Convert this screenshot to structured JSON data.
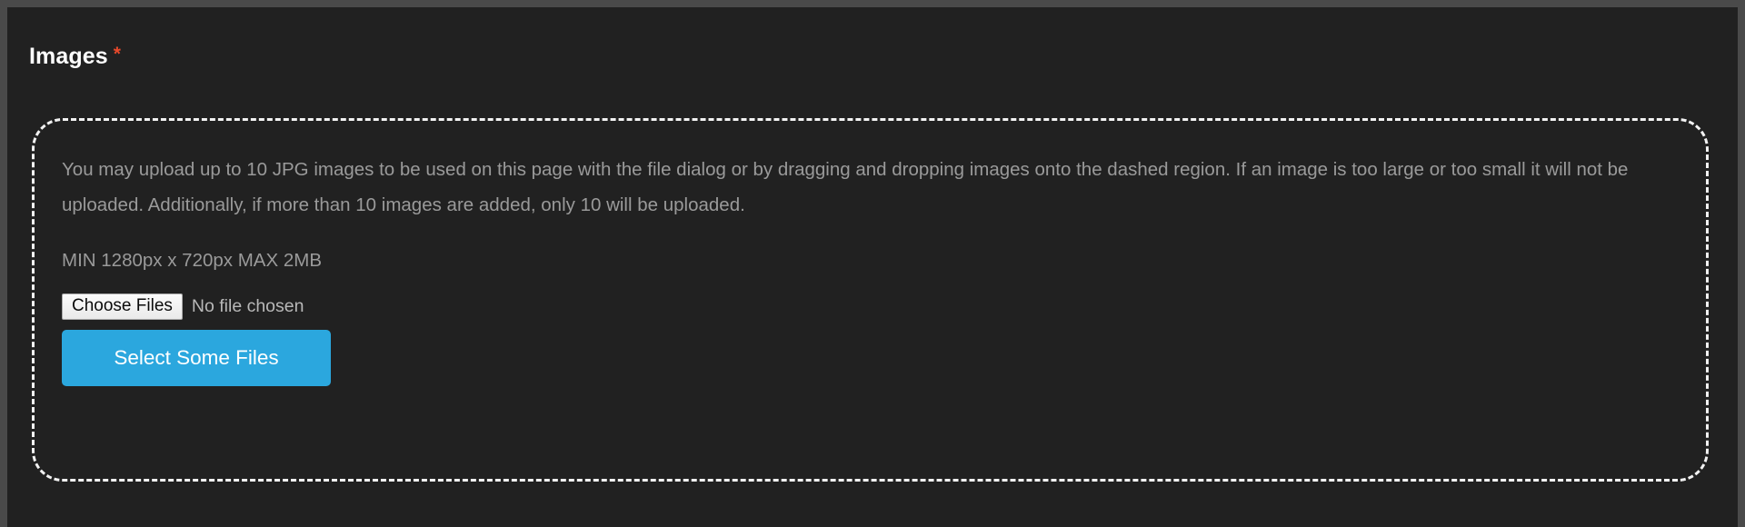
{
  "form_field": {
    "label": "Images",
    "required_marker": "*",
    "required_color": "#e8492b"
  },
  "dropzone": {
    "help_text": "You may upload up to 10 JPG images to be used on this page with the file dialog or by dragging and dropping images onto the dashed region. If an image is too large or too small it will not be uploaded. Additionally, if more than 10 images are added, only 10 will be uploaded.",
    "spec_text": "MIN 1280px x 720px MAX 2MB",
    "border_color": "#f2f2f2"
  },
  "file_input": {
    "button_label": "Choose Files",
    "status_text": "No file chosen"
  },
  "primary_action": {
    "label": "Select Some Files",
    "color": "#2ba7de"
  },
  "theme": {
    "page_background": "#212121",
    "window_background": "#4a4a4a",
    "muted_text": "#9a9a9a"
  }
}
